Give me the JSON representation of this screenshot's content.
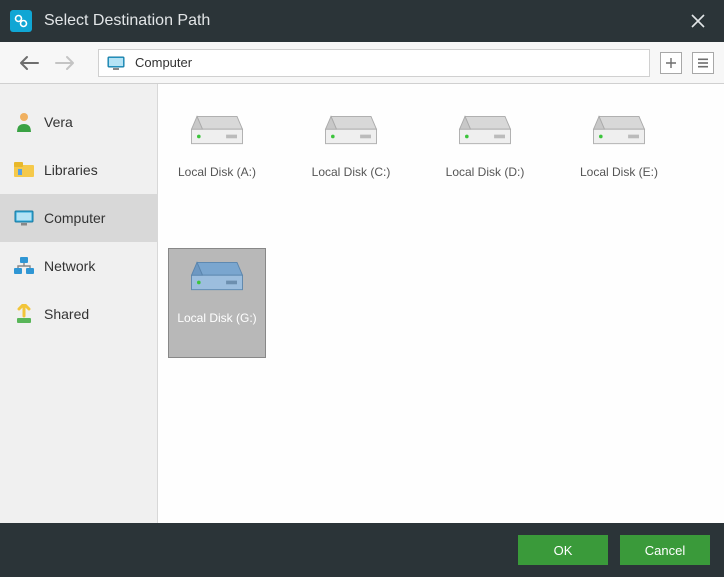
{
  "window": {
    "title": "Select Destination Path"
  },
  "toolbar": {
    "path": "Computer"
  },
  "sidebar": {
    "items": [
      {
        "label": "Vera",
        "icon": "user-icon"
      },
      {
        "label": "Libraries",
        "icon": "libraries-icon"
      },
      {
        "label": "Computer",
        "icon": "monitor-icon",
        "selected": true
      },
      {
        "label": "Network",
        "icon": "network-icon"
      },
      {
        "label": "Shared",
        "icon": "shared-icon"
      }
    ]
  },
  "drives": [
    {
      "label": "Local Disk (A:)",
      "selected": false,
      "color": "gray"
    },
    {
      "label": "Local Disk (C:)",
      "selected": false,
      "color": "gray"
    },
    {
      "label": "Local Disk (D:)",
      "selected": false,
      "color": "gray"
    },
    {
      "label": "Local Disk (E:)",
      "selected": false,
      "color": "gray"
    },
    {
      "label": "Local Disk (G:)",
      "selected": true,
      "color": "blue"
    }
  ],
  "footer": {
    "ok": "OK",
    "cancel": "Cancel"
  }
}
